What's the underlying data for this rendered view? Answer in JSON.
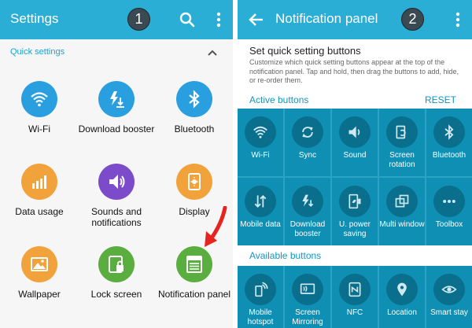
{
  "left_screen": {
    "title": "Settings",
    "step_number": "1",
    "section_header": "Quick settings",
    "icons": {
      "search": "search-icon",
      "menu": "more-vert-icon",
      "collapse": "chevron-up-icon"
    },
    "items": [
      {
        "label": "Wi-Fi",
        "icon": "wifi-icon",
        "color": "#2a9fdf"
      },
      {
        "label": "Download booster",
        "icon": "download-booster-icon",
        "color": "#2a9fdf"
      },
      {
        "label": "Bluetooth",
        "icon": "bluetooth-icon",
        "color": "#2a9fdf"
      },
      {
        "label": "Data usage",
        "icon": "data-usage-icon",
        "color": "#f2a23a"
      },
      {
        "label": "Sounds and notifications",
        "icon": "sound-icon",
        "color": "#7b4bc9"
      },
      {
        "label": "Display",
        "icon": "display-icon",
        "color": "#f2a23a"
      },
      {
        "label": "Wallpaper",
        "icon": "wallpaper-icon",
        "color": "#f2a23a"
      },
      {
        "label": "Lock screen",
        "icon": "lock-screen-icon",
        "color": "#5aae3f"
      },
      {
        "label": "Notification panel",
        "icon": "notification-panel-icon",
        "color": "#5aae3f"
      }
    ],
    "annotation_arrow_color": "#e8231f"
  },
  "right_screen": {
    "title": "Notification panel",
    "step_number": "2",
    "icons": {
      "back": "back-arrow-icon",
      "menu": "more-vert-icon"
    },
    "info_heading": "Set quick setting buttons",
    "info_description": "Customize which quick setting buttons appear at the top of the notification panel. Tap and hold, then drag the buttons to add, hide, or re-order them.",
    "active_label": "Active buttons",
    "reset_label": "RESET",
    "available_label": "Available buttons",
    "active_buttons": [
      {
        "label": "Wi-Fi",
        "icon": "wifi-icon"
      },
      {
        "label": "Sync",
        "icon": "sync-icon"
      },
      {
        "label": "Sound",
        "icon": "sound-icon"
      },
      {
        "label": "Screen rotation",
        "icon": "screen-rotation-icon"
      },
      {
        "label": "Bluetooth",
        "icon": "bluetooth-icon"
      },
      {
        "label": "Mobile data",
        "icon": "mobile-data-icon"
      },
      {
        "label": "Download booster",
        "icon": "download-booster-icon"
      },
      {
        "label": "U. power saving",
        "icon": "power-saving-icon"
      },
      {
        "label": "Multi window",
        "icon": "multi-window-icon"
      },
      {
        "label": "Toolbox",
        "icon": "toolbox-icon"
      }
    ],
    "available_buttons": [
      {
        "label": "Mobile hotspot",
        "icon": "hotspot-icon"
      },
      {
        "label": "Screen Mirroring",
        "icon": "screen-mirroring-icon"
      },
      {
        "label": "NFC",
        "icon": "nfc-icon"
      },
      {
        "label": "Location",
        "icon": "location-icon"
      },
      {
        "label": "Smart stay",
        "icon": "smart-stay-icon"
      }
    ]
  }
}
